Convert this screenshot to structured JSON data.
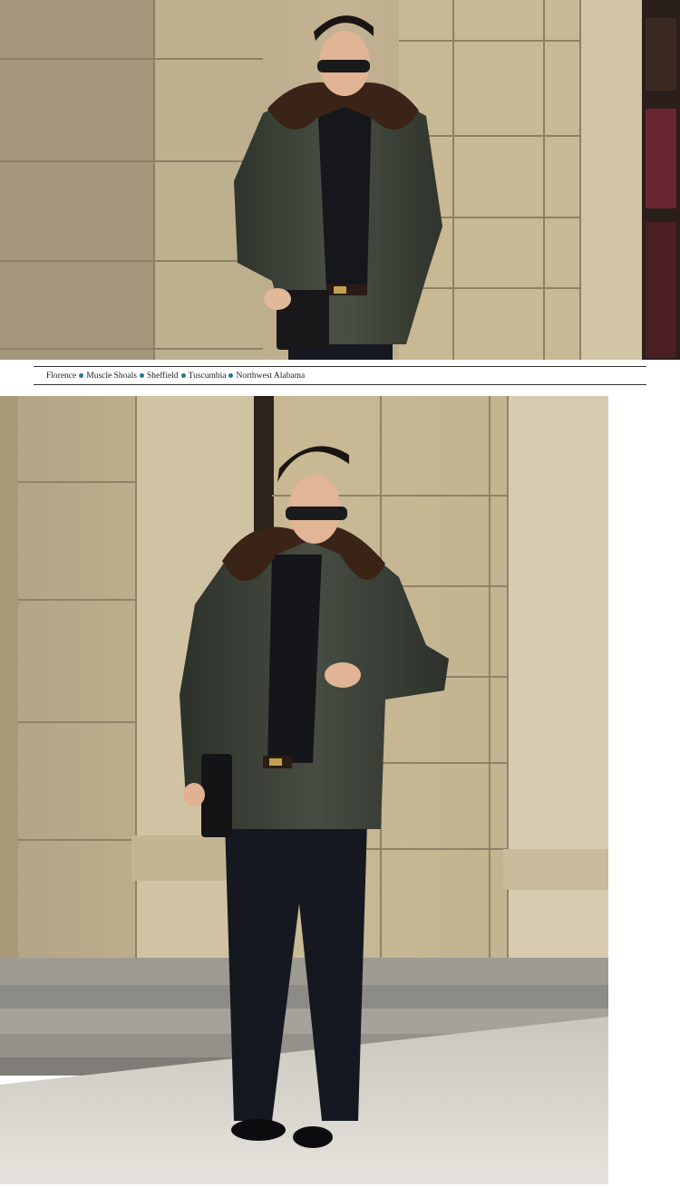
{
  "nav": {
    "dot_color": "#1f7a8c",
    "items": [
      {
        "label": "Florence"
      },
      {
        "label": "Muscle Shoals"
      },
      {
        "label": "Sheffield"
      },
      {
        "label": "Tuscumbia"
      },
      {
        "label": "Northwest Alabama"
      }
    ]
  },
  "photos": {
    "top": {
      "subject": "model-walking-hand-on-clutch"
    },
    "bottom": {
      "subject": "model-checking-watch"
    }
  },
  "colors": {
    "stone": "#b9a888",
    "jacket": "#3d4238",
    "fur": "#3a2418",
    "trousers": "#151820"
  }
}
